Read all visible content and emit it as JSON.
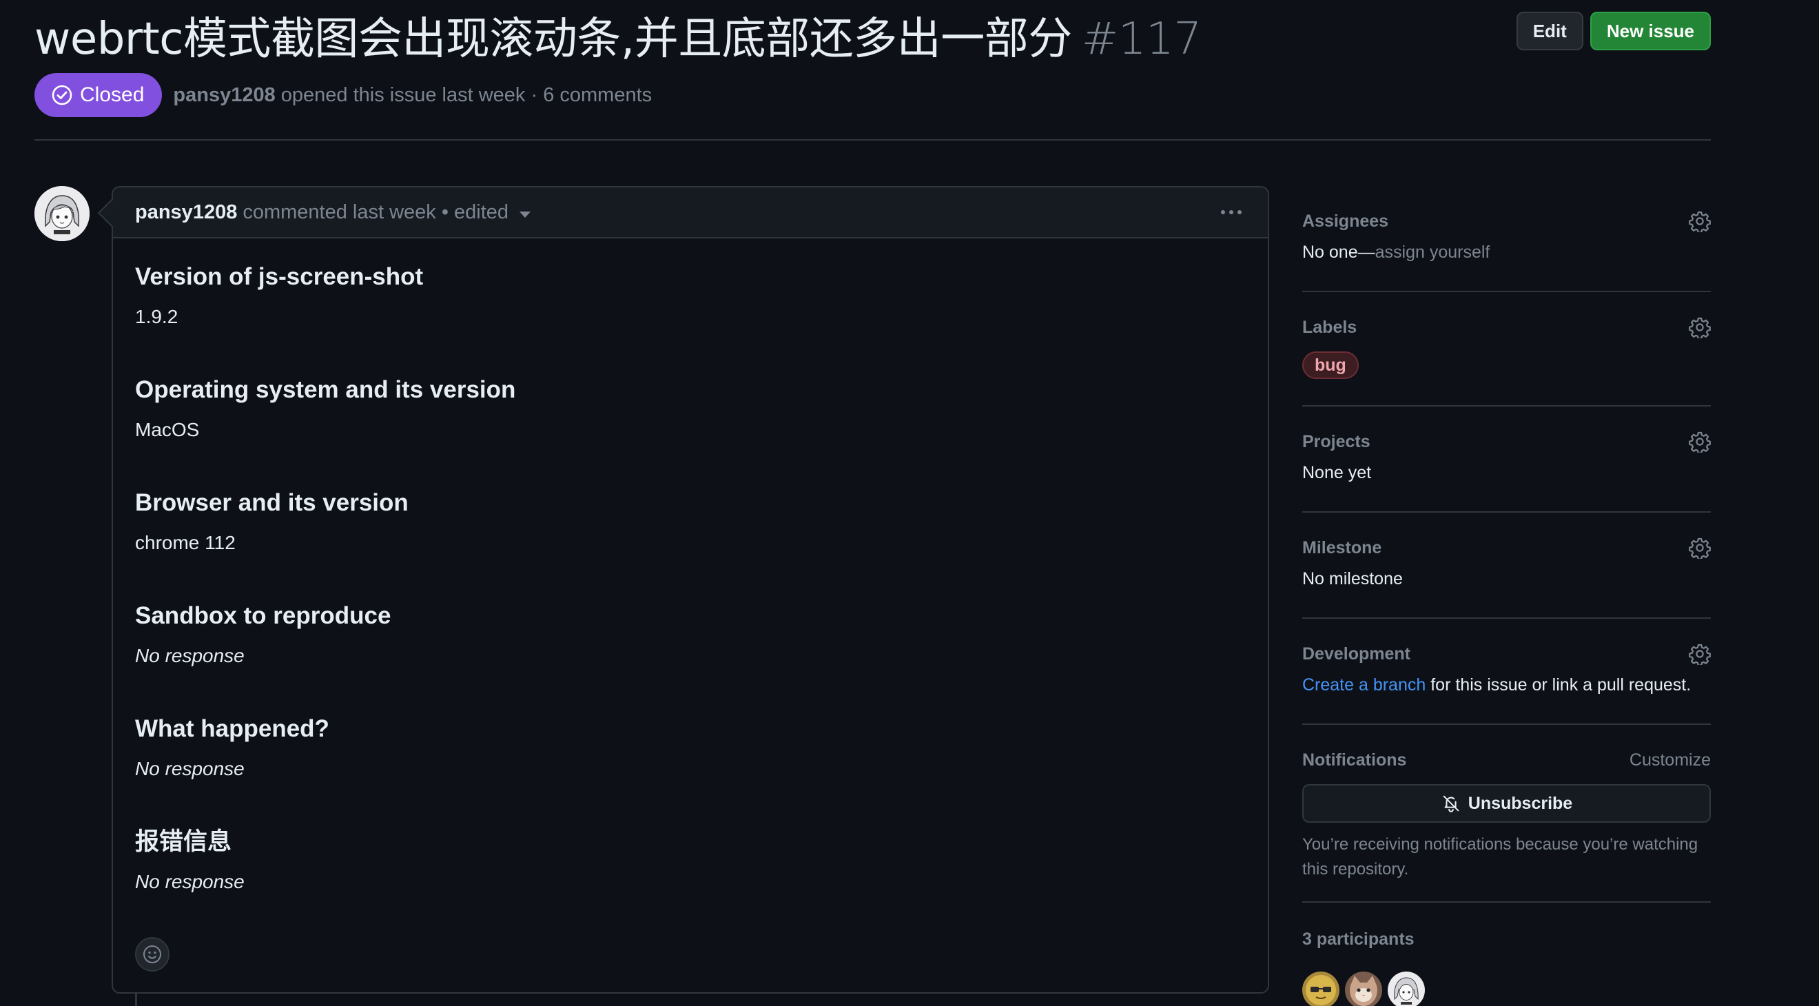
{
  "issue": {
    "title": "webrtc模式截图会出现滚动条,并且底部还多出一部分",
    "number": "#117",
    "state": "Closed",
    "author": "pansy1208",
    "opened_text": "opened this issue last week · 6 comments"
  },
  "header_actions": {
    "edit_label": "Edit",
    "new_issue_label": "New issue"
  },
  "comment": {
    "author": "pansy1208",
    "meta": "commented last week • edited",
    "sections": [
      {
        "heading": "Version of js-screen-shot",
        "value": "1.9.2",
        "italic": false
      },
      {
        "heading": "Operating system and its version",
        "value": "MacOS",
        "italic": false
      },
      {
        "heading": "Browser and its version",
        "value": "chrome 112",
        "italic": false
      },
      {
        "heading": "Sandbox to reproduce",
        "value": "No response",
        "italic": true
      },
      {
        "heading": "What happened?",
        "value": "No response",
        "italic": true
      },
      {
        "heading": "报错信息",
        "value": "No response",
        "italic": true
      }
    ]
  },
  "sidebar": {
    "assignees": {
      "title": "Assignees",
      "none": "No one—",
      "assign_link": "assign yourself"
    },
    "labels": {
      "title": "Labels",
      "items": [
        "bug"
      ]
    },
    "projects": {
      "title": "Projects",
      "value": "None yet"
    },
    "milestone": {
      "title": "Milestone",
      "value": "No milestone"
    },
    "development": {
      "title": "Development",
      "link": "Create a branch",
      "rest": " for this issue or link a pull request."
    },
    "notifications": {
      "title": "Notifications",
      "customize": "Customize",
      "button": "Unsubscribe",
      "note": "You’re receiving notifications because you’re watching this repository."
    },
    "participants": {
      "title": "3 participants"
    }
  },
  "colors": {
    "background": "#0d1117",
    "closed_badge": "#8250df",
    "primary_button": "#238636",
    "link": "#4493f8",
    "label_bug": "#f0a6ae"
  }
}
